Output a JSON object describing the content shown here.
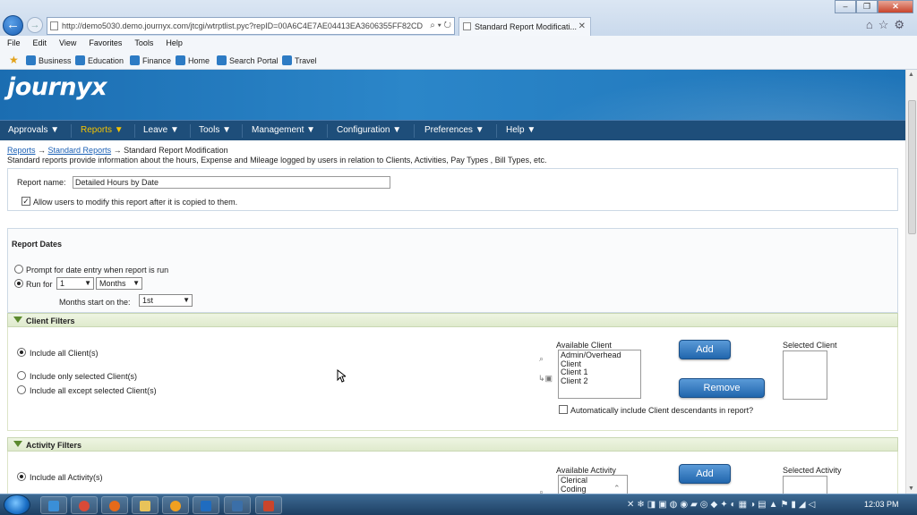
{
  "browser": {
    "url": "http://demo5030.demo.journyx.com/jtcgi/wtrptlist.pyc?repID=00A6C4E7AE04413EA3606355FF82CD",
    "tab_title": "Standard Report Modificati...",
    "menu": [
      "File",
      "Edit",
      "View",
      "Favorites",
      "Tools",
      "Help"
    ],
    "favorites": [
      "Business",
      "Education",
      "Finance",
      "Home",
      "Search Portal",
      "Travel"
    ]
  },
  "app": {
    "logo_text": "journyx",
    "nav": [
      "Approvals ▼",
      "Reports ▼",
      "Leave ▼",
      "Tools ▼",
      "Management ▼",
      "Configuration ▼",
      "Preferences ▼",
      "Help ▼"
    ],
    "active_nav_index": 1
  },
  "breadcrumb": {
    "link1": "Reports",
    "sep1": " → ",
    "link2": "Standard Reports",
    "sep2": " → ",
    "current": "Standard Report Modification"
  },
  "description": "Standard reports provide information about the hours, Expense and Mileage logged by users in relation to Clients, Activities, Pay Types , Bill Types, etc.",
  "report": {
    "name_label": "Report name:",
    "name_value": "Detailed Hours by Date",
    "allow_modify_label": "Allow users to modify this report after it is copied to them."
  },
  "report_dates": {
    "title": "Report Dates",
    "prompt_label": "Prompt for date entry when report is run",
    "run_for_label": "Run for",
    "run_for_value": "1",
    "unit_value": "Months",
    "months_start_label": "Months start on the:",
    "months_start_value": "1st"
  },
  "client_filters": {
    "title": "Client Filters",
    "opt_all": "Include all Client(s)",
    "opt_only": "Include only selected Client(s)",
    "opt_except": "Include all except selected Client(s)",
    "available_label": "Available Client",
    "available_items": [
      "Admin/Overhead",
      "Client",
      "Client 1",
      "Client 2"
    ],
    "add_label": "Add",
    "remove_label": "Remove",
    "selected_label": "Selected Client",
    "auto_descendants_label": "Automatically include Client descendants in report?"
  },
  "activity_filters": {
    "title": "Activity Filters",
    "opt_all": "Include all Activity(s)",
    "available_label": "Available Activity",
    "available_items": [
      "Clerical",
      "Coding"
    ],
    "add_label": "Add",
    "selected_label": "Selected Activity"
  },
  "taskbar": {
    "clock": "12:03 PM"
  }
}
